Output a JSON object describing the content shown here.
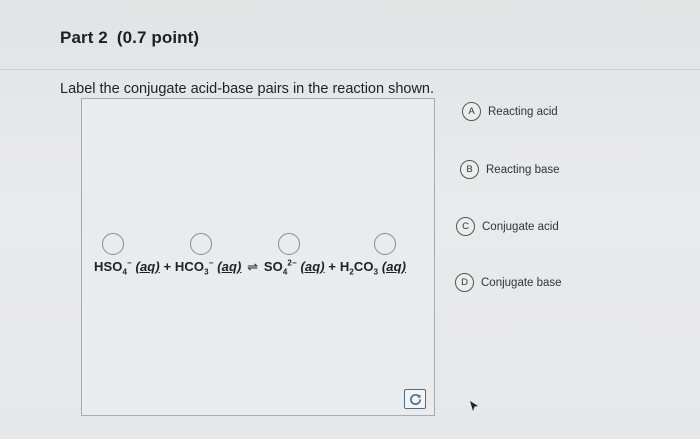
{
  "header": {
    "part_label": "Part 2",
    "points_label": "(0.7 point)"
  },
  "question": {
    "prompt": "Label the conjugate acid-base pairs in the reaction shown."
  },
  "equation": {
    "species": [
      {
        "formula": "HSO",
        "sub": "4",
        "sup": "−",
        "state": "(aq)"
      },
      {
        "formula": "HCO",
        "sub": "3",
        "sup": "−",
        "state": "(aq)"
      },
      {
        "formula": "SO",
        "sub": "4",
        "sup": "2−",
        "state": "(aq)"
      },
      {
        "formula": "H",
        "sub": "2",
        "formula2": "CO",
        "sub2": "3",
        "state": "(aq)"
      }
    ],
    "plus": "+",
    "arrow": "⇌"
  },
  "options": [
    {
      "letter": "A",
      "label": "Reacting acid"
    },
    {
      "letter": "B",
      "label": "Reacting base"
    },
    {
      "letter": "C",
      "label": "Conjugate acid"
    },
    {
      "letter": "D",
      "label": "Conjugate base"
    }
  ],
  "icons": {
    "reset": "reset-icon",
    "cursor": "mouse-cursor-icon"
  },
  "colors": {
    "reset_accent": "#4b6e8c"
  }
}
